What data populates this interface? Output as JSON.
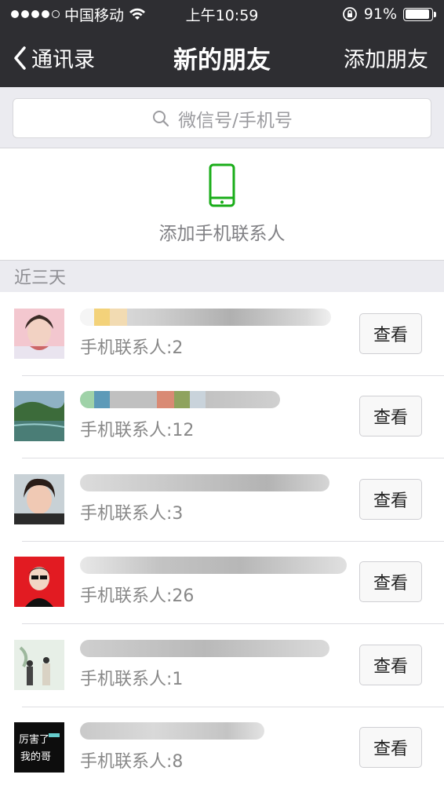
{
  "status_bar": {
    "carrier": "中国移动",
    "time": "上午10:59",
    "battery_percent": "91%",
    "battery_level": 0.91,
    "signal_bars_filled": 4,
    "signal_bars_total": 5
  },
  "nav": {
    "back_label": "通讯录",
    "title": "新的朋友",
    "right_action": "添加朋友"
  },
  "search": {
    "placeholder": "微信号/手机号"
  },
  "add_phone_contacts": {
    "label": "添加手机联系人",
    "icon": "phone-icon",
    "icon_color": "#1aad19"
  },
  "section": {
    "header": "近三天"
  },
  "friends": [
    {
      "contacts": "手机联系人:2",
      "action": "查看"
    },
    {
      "contacts": "手机联系人:12",
      "action": "查看"
    },
    {
      "contacts": "手机联系人:3",
      "action": "查看"
    },
    {
      "contacts": "手机联系人:26",
      "action": "查看"
    },
    {
      "contacts": "手机联系人:1",
      "action": "查看"
    },
    {
      "contacts": "手机联系人:8",
      "action": "查看"
    }
  ],
  "colors": {
    "nav_bg": "#2e2e32",
    "page_bg": "#ebebf0",
    "accent_green": "#1aad19"
  }
}
